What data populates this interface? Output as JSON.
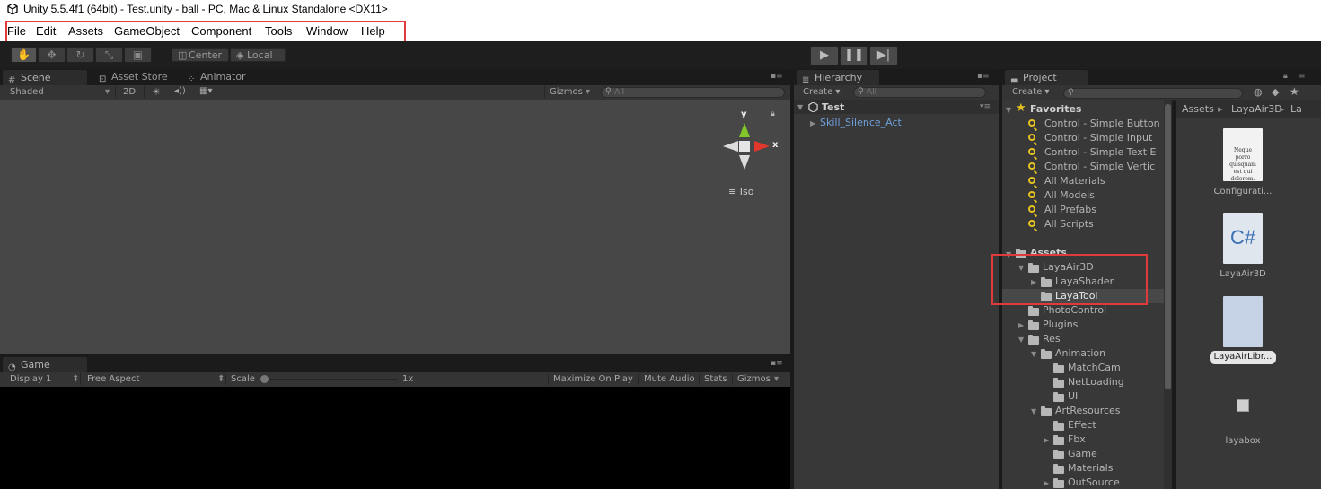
{
  "window": {
    "title": "Unity 5.5.4f1 (64bit) - Test.unity - ball - PC, Mac & Linux Standalone <DX11>"
  },
  "menu": [
    "File",
    "Edit",
    "Assets",
    "GameObject",
    "Component",
    "Tools",
    "Window",
    "Help"
  ],
  "toolbar": {
    "pivot": "Center",
    "space": "Local",
    "play": "▶",
    "pause": "❚❚",
    "step": "▶|"
  },
  "scene": {
    "tabs": [
      "Scene",
      "Asset Store",
      "Animator"
    ],
    "shading": "Shaded",
    "mode_2d": "2D",
    "gizmos": "Gizmos",
    "search_placeholder": "All",
    "gizmo_y": "y",
    "gizmo_x": "x",
    "projection": "Iso"
  },
  "game": {
    "tab": "Game",
    "display": "Display 1",
    "aspect": "Free Aspect",
    "scale_label": "Scale",
    "scale_value": "1x",
    "maximize": "Maximize On Play",
    "mute": "Mute Audio",
    "stats": "Stats",
    "gizmos": "Gizmos"
  },
  "hierarchy": {
    "tab": "Hierarchy",
    "create": "Create",
    "search_placeholder": "All",
    "scene_name": "Test",
    "items": [
      "Skill_Silence_Act"
    ]
  },
  "project": {
    "tab": "Project",
    "create": "Create",
    "favorites_label": "Favorites",
    "favorites": [
      "Control - Simple Button",
      "Control - Simple Input",
      "Control - Simple Text E",
      "Control - Simple Vertic",
      "All Materials",
      "All Models",
      "All Prefabs",
      "All Scripts"
    ],
    "assets_label": "Assets",
    "tree": [
      {
        "label": "LayaAir3D",
        "depth": 1,
        "arrow": "open"
      },
      {
        "label": "LayaShader",
        "depth": 2,
        "arrow": "closed"
      },
      {
        "label": "LayaTool",
        "depth": 2,
        "arrow": "none"
      },
      {
        "label": "PhotoControl",
        "depth": 1,
        "arrow": "none"
      },
      {
        "label": "Plugins",
        "depth": 1,
        "arrow": "closed"
      },
      {
        "label": "Res",
        "depth": 1,
        "arrow": "open"
      },
      {
        "label": "Animation",
        "depth": 2,
        "arrow": "open"
      },
      {
        "label": "MatchCam",
        "depth": 3,
        "arrow": "none"
      },
      {
        "label": "NetLoading",
        "depth": 3,
        "arrow": "none"
      },
      {
        "label": "UI",
        "depth": 3,
        "arrow": "none"
      },
      {
        "label": "ArtResources",
        "depth": 2,
        "arrow": "open"
      },
      {
        "label": "Effect",
        "depth": 3,
        "arrow": "none"
      },
      {
        "label": "Fbx",
        "depth": 3,
        "arrow": "closed"
      },
      {
        "label": "Game",
        "depth": 3,
        "arrow": "none"
      },
      {
        "label": "Materials",
        "depth": 3,
        "arrow": "none"
      },
      {
        "label": "OutSource",
        "depth": 3,
        "arrow": "closed"
      }
    ],
    "breadcrumb": [
      "Assets",
      "LayaAir3D",
      "La"
    ],
    "assets": [
      {
        "name": "Configurati...",
        "kind": "doc",
        "doc_text": "Neque porro quisquam est qui dolorem."
      },
      {
        "name": "LayaAir3D",
        "kind": "csharp",
        "doc_text": "C#"
      },
      {
        "name": "LayaAirLibr...",
        "kind": "blank",
        "doc_text": ""
      },
      {
        "name": "layabox",
        "kind": "small",
        "doc_text": ""
      }
    ]
  },
  "colors": {
    "highlight": "#e03a3a",
    "favorite_star": "#e4c21f",
    "hierarchy_item": "#6fa1dc"
  }
}
